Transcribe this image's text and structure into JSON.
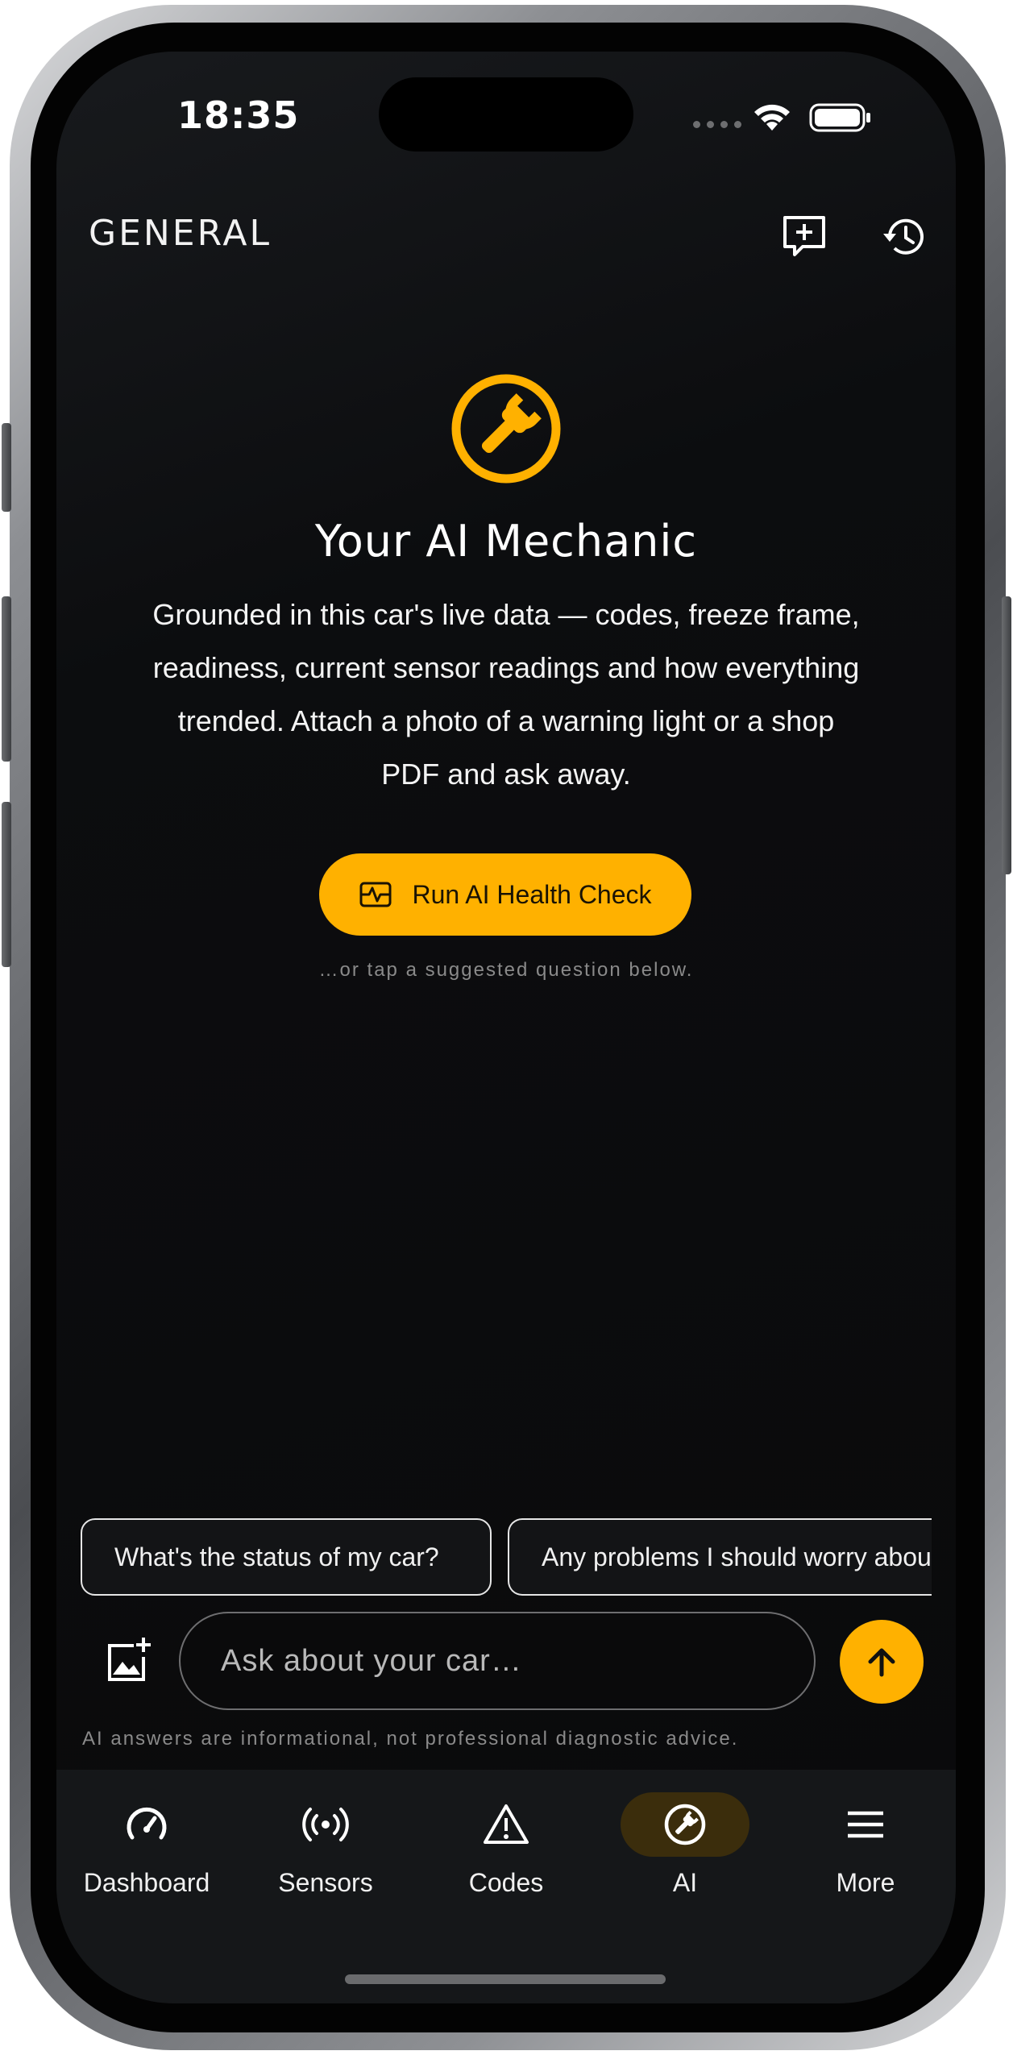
{
  "status_bar": {
    "time": "18:35",
    "icons": [
      "signal-dots-icon",
      "wifi-icon",
      "battery-icon"
    ]
  },
  "header": {
    "brand": "GENERAL",
    "actions": [
      {
        "icon": "new-chat-icon"
      },
      {
        "icon": "history-icon"
      }
    ]
  },
  "hero": {
    "icon": "wrench-icon",
    "title": "Your AI Mechanic",
    "description": "Grounded in this car's live data — codes, freeze frame, readiness, current sensor readings and how everything trended. Attach a photo of a warning light or a shop PDF and ask away.",
    "cta_label": "Run AI Health Check",
    "cta_icon": "health-check-icon",
    "hint": "…or tap a suggested question below."
  },
  "suggestions": [
    "What's the status of my car?",
    "Any problems I should worry about?"
  ],
  "composer": {
    "placeholder": "Ask about your car…",
    "attach_icon": "add-photo-icon",
    "send_icon": "arrow-up-icon",
    "disclaimer": "AI answers are informational, not professional diagnostic advice."
  },
  "nav": {
    "items": [
      {
        "label": "Dashboard",
        "icon": "gauge-icon",
        "active": false
      },
      {
        "label": "Sensors",
        "icon": "broadcast-icon",
        "active": false
      },
      {
        "label": "Codes",
        "icon": "warning-icon",
        "active": false
      },
      {
        "label": "AI",
        "icon": "wrench-icon",
        "active": true
      },
      {
        "label": "More",
        "icon": "menu-icon",
        "active": false
      }
    ]
  },
  "colors": {
    "accent": "#ffb100",
    "background": "#0a0a0b",
    "nav_background": "#151719",
    "active_pill": "#3b2d0c",
    "muted_text": "#8a8a8a"
  }
}
